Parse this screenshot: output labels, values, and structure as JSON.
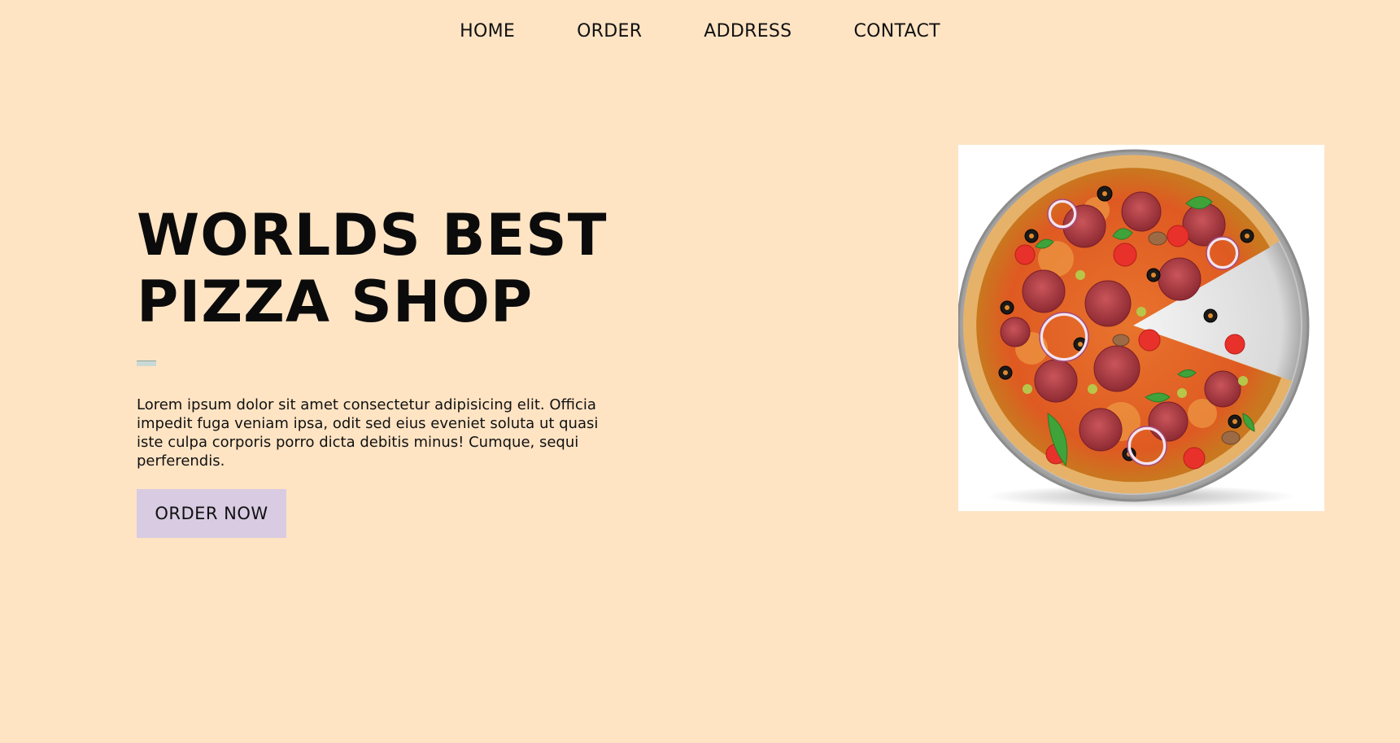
{
  "nav": {
    "items": [
      {
        "label": "HOME"
      },
      {
        "label": "ORDER"
      },
      {
        "label": "ADDRESS"
      },
      {
        "label": "CONTACT"
      }
    ]
  },
  "hero": {
    "title_line1": "WORLDS BEST",
    "title_line2": "PIZZA SHOP",
    "description": "Lorem ipsum dolor sit amet consectetur adipisicing elit. Officia impedit fuga veniam ipsa, odit sed eius eveniet soluta ut quasi iste culpa corporis porro dicta debitis minus! Cumque, sequi perferendis.",
    "cta_label": "ORDER NOW"
  },
  "colors": {
    "background": "#ffe4c4",
    "cta_background": "#d8cbe2",
    "text": "#111111"
  },
  "image": {
    "subject": "pizza-with-missing-slice"
  }
}
